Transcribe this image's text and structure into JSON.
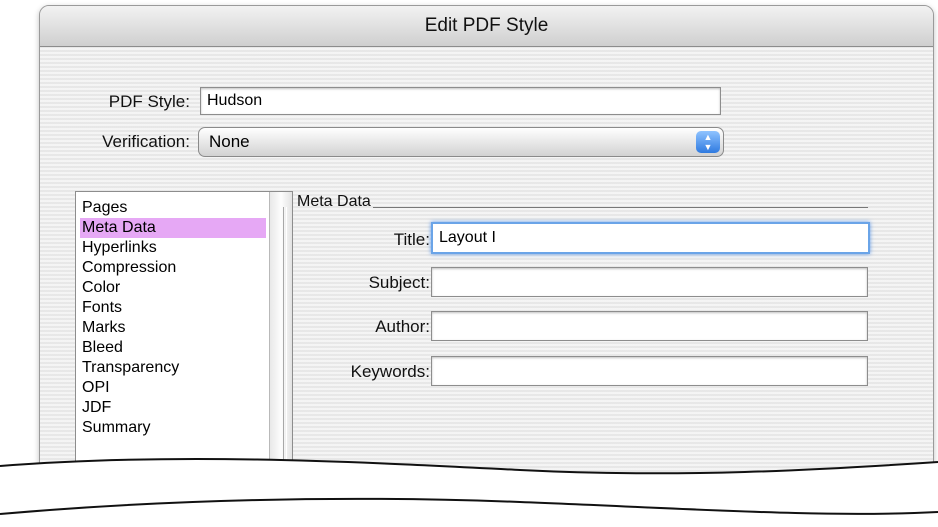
{
  "window": {
    "title": "Edit PDF Style"
  },
  "form": {
    "pdf_style_label": "PDF Style:",
    "pdf_style_value": "Hudson",
    "verification_label": "Verification:",
    "verification_value": "None"
  },
  "sidebar": {
    "items": [
      {
        "label": "Pages"
      },
      {
        "label": "Meta Data",
        "selected": true
      },
      {
        "label": "Hyperlinks"
      },
      {
        "label": "Compression"
      },
      {
        "label": "Color"
      },
      {
        "label": "Fonts"
      },
      {
        "label": "Marks"
      },
      {
        "label": "Bleed"
      },
      {
        "label": "Transparency"
      },
      {
        "label": "OPI"
      },
      {
        "label": "JDF"
      },
      {
        "label": "Summary"
      }
    ]
  },
  "meta_data": {
    "group_title": "Meta Data",
    "title_label": "Title:",
    "title_value": "Layout I",
    "subject_label": "Subject:",
    "subject_value": "",
    "author_label": "Author:",
    "author_value": "",
    "keywords_label": "Keywords:",
    "keywords_value": ""
  },
  "colors": {
    "selection": "#e6a8f5",
    "focus_ring": "#6aa4e8",
    "popup_arrow": "#2f7ae0"
  },
  "icons": {
    "popup_arrows": "up-down-arrows-icon"
  }
}
